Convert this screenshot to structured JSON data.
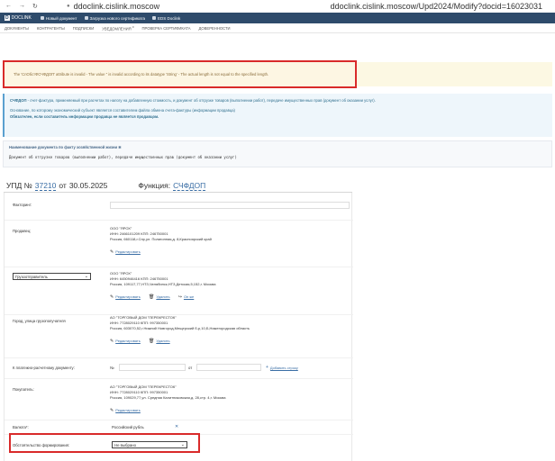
{
  "browser": {
    "back": "←",
    "forward": "→",
    "reload": "↻",
    "host": "ddoclink.cislink.moscow",
    "full_url": "ddoclink.cislink.moscow/Upd2024/Modify?docid=16023031"
  },
  "app_bar": {
    "logo": "D",
    "brand": "DOCLINK",
    "items": [
      "Новый документ",
      "Загрузка нового сертификата",
      "EDS Doclink"
    ]
  },
  "menu": {
    "items": [
      "ДОКУМЕНТЫ",
      "КОНТРАГЕНТЫ",
      "ПОДПИСКИ",
      "УВЕДОМЛЕНИЯ",
      "ПРОВЕРКА СЕРТИФИКАТА",
      "ДОВЕРЕННОСТИ"
    ],
    "badge": "0"
  },
  "error": {
    "text": "The 'СпОбстФСЧФДОП' attribute is invalid - The value '' is invalid according to its datatype 'String' - The actual length is not equal to the specified length."
  },
  "info": {
    "line1_bold": "СЧФДОП",
    "line1": " - счет-фактура, применяемый при расчетах по налогу на добавленную стоимость, и документ об отгрузке товаров (выполнении работ), передаче имущественных прав (документ об оказании услуг).",
    "line2": "Основание, по которому экономический субъект является составителем файла обмена счета-фактуры (информации продавца)",
    "line3": "Обязателен, если составитель информации продавца не является продавцом."
  },
  "doc_name": {
    "label": "Наименование документа по факту хозяйственной жизни ✻",
    "value": "Документ об отгрузке товаров (выполнении работ), передаче имущественных прав (документ об оказании услуг)"
  },
  "heading": {
    "prefix": "УПД №",
    "number": "37210",
    "from": "от",
    "date": "30.05.2025",
    "function_label": "Функция:",
    "function_value": "СЧФДОП"
  },
  "form": {
    "factoring_label": "Факторинг:",
    "seller": {
      "label": "Продавец:",
      "name": "ООО \"ЯРОХ\"",
      "inn": "ИНН: 2466101209 КПП: 246750001",
      "address": "Россия, 660118,г.Спр,ул. Полигонная,д. 8,Красноярский край",
      "edit": "Редактировать"
    },
    "shipper": {
      "select_value": "Грузоотправитель",
      "name": "ООО \"ЯРОХ\"",
      "inn": "ИНН: 6450946416 КПП: 246750001",
      "address": "Россия, 109117,77,НТЗ,Челябинск,НТЗ,Детская,5,152,г. Москва",
      "edit": "Редактировать",
      "delete": "Удалить",
      "same": "Он же"
    },
    "consignee": {
      "hint": "Город, улица грузополучателя",
      "name": "АО \"ТОРГОВЫЙ ДОМ \"ПЕРЕКРЕСТОК\"",
      "inn": "ИНН: 7728029110 КПП: 997350001",
      "address": "Россия, 603070,52,г.Нижний Новгород,Мещерский б-р,10,Б,Нижегородская область",
      "edit": "Редактировать",
      "delete": "Удалить"
    },
    "payment_doc": {
      "label": "К платежно-расчетному документу:",
      "no": "№",
      "from": "от",
      "add": "Добавить строку"
    },
    "buyer": {
      "label": "Покупатель:",
      "name": "АО \"ТОРГОВЫЙ ДОМ \"ПЕРЕКРЕСТОК\"",
      "inn": "ИНН: 7728029110 КПП: 997350001",
      "address": "Россия, 109029,77,ул. Средняя Калитниковская,д. 28,стр. 4,г. Москва",
      "edit": "Редактировать"
    },
    "currency": {
      "label": "Валюта*:",
      "value": "Российский рубль",
      "clear": "✕"
    },
    "circumstance": {
      "label": "Обстоятельство формирования:",
      "value": "Не выбрано"
    }
  }
}
